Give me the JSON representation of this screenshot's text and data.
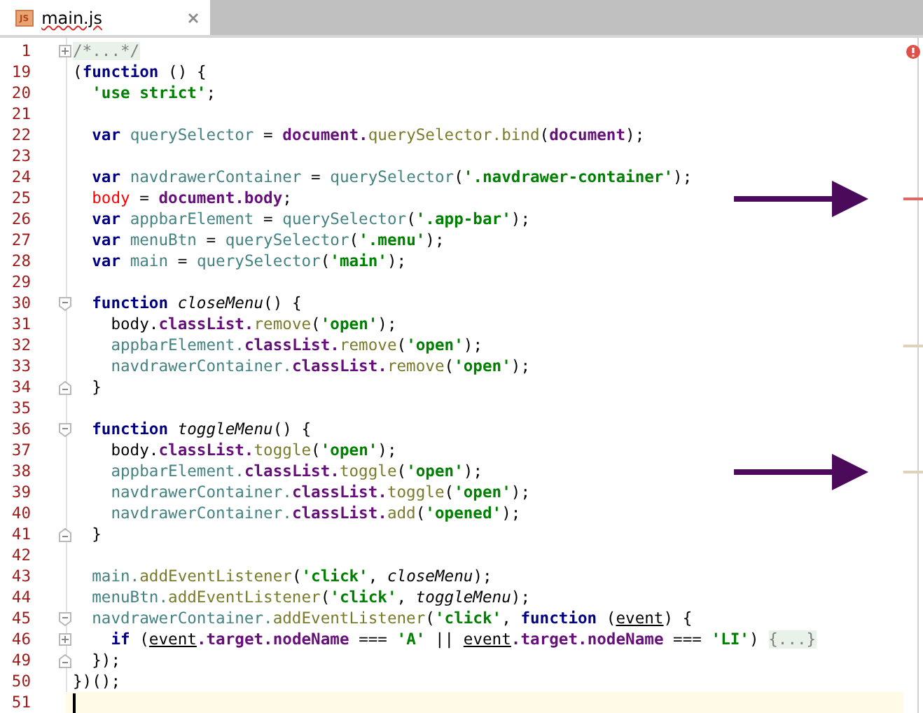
{
  "tabs": [
    {
      "label": "main.js",
      "icon_text": "JS",
      "selected": true,
      "misspelled": true
    }
  ],
  "editor": {
    "has_errors": true,
    "lines": [
      {
        "number": "1",
        "fold": {
          "kind": "expand"
        },
        "current": false,
        "arrow": false,
        "tokens": [
          {
            "text": "/*...*/",
            "kind": "folded"
          }
        ]
      },
      {
        "number": "19",
        "current": false,
        "arrow": false,
        "tokens": [
          {
            "text": "(",
            "kind": "plain"
          },
          {
            "text": "function",
            "kind": "keyword"
          },
          {
            "text": " () {",
            "kind": "plain"
          }
        ]
      },
      {
        "number": "20",
        "current": false,
        "arrow": false,
        "tokens": [
          {
            "text": "  'use strict'",
            "kind": "string"
          },
          {
            "text": ";",
            "kind": "plain"
          }
        ]
      },
      {
        "number": "21",
        "current": false,
        "arrow": false
      },
      {
        "number": "22",
        "current": false,
        "arrow": false,
        "tokens": [
          {
            "text": "  var ",
            "kind": "keyword"
          },
          {
            "text": "querySelector",
            "kind": "local"
          },
          {
            "text": " = ",
            "kind": "plain"
          },
          {
            "text": "document.",
            "kind": "property"
          },
          {
            "text": "querySelector.bind",
            "kind": "method"
          },
          {
            "text": "(",
            "kind": "plain"
          },
          {
            "text": "document",
            "kind": "property"
          },
          {
            "text": ");",
            "kind": "plain"
          }
        ]
      },
      {
        "number": "23",
        "current": false,
        "arrow": false
      },
      {
        "number": "24",
        "current": false,
        "arrow": false,
        "tokens": [
          {
            "text": "  var ",
            "kind": "keyword"
          },
          {
            "text": "navdrawerContainer",
            "kind": "local"
          },
          {
            "text": " = ",
            "kind": "plain"
          },
          {
            "text": "querySelector",
            "kind": "local"
          },
          {
            "text": "(",
            "kind": "plain"
          },
          {
            "text": "'.navdrawer-container'",
            "kind": "string"
          },
          {
            "text": ");",
            "kind": "plain"
          }
        ]
      },
      {
        "number": "25",
        "current": false,
        "arrow": true,
        "stripe": {
          "kind": "error"
        },
        "tokens": [
          {
            "text": "  body",
            "kind": "global"
          },
          {
            "text": " = ",
            "kind": "plain"
          },
          {
            "text": "document.body",
            "kind": "property"
          },
          {
            "text": ";",
            "kind": "plain"
          }
        ]
      },
      {
        "number": "26",
        "current": false,
        "arrow": false,
        "tokens": [
          {
            "text": "  var ",
            "kind": "keyword"
          },
          {
            "text": "appbarElement",
            "kind": "local"
          },
          {
            "text": " = ",
            "kind": "plain"
          },
          {
            "text": "querySelector",
            "kind": "local"
          },
          {
            "text": "(",
            "kind": "plain"
          },
          {
            "text": "'.app-bar'",
            "kind": "string"
          },
          {
            "text": ");",
            "kind": "plain"
          }
        ]
      },
      {
        "number": "27",
        "current": false,
        "arrow": false,
        "tokens": [
          {
            "text": "  var ",
            "kind": "keyword"
          },
          {
            "text": "menuBtn",
            "kind": "local"
          },
          {
            "text": " = ",
            "kind": "plain"
          },
          {
            "text": "querySelector",
            "kind": "local"
          },
          {
            "text": "(",
            "kind": "plain"
          },
          {
            "text": "'.menu'",
            "kind": "string"
          },
          {
            "text": ");",
            "kind": "plain"
          }
        ]
      },
      {
        "number": "28",
        "current": false,
        "arrow": false,
        "tokens": [
          {
            "text": "  var ",
            "kind": "keyword"
          },
          {
            "text": "main",
            "kind": "local"
          },
          {
            "text": " = ",
            "kind": "plain"
          },
          {
            "text": "querySelector",
            "kind": "local"
          },
          {
            "text": "(",
            "kind": "plain"
          },
          {
            "text": "'main'",
            "kind": "string"
          },
          {
            "text": ");",
            "kind": "plain"
          }
        ]
      },
      {
        "number": "29",
        "current": false,
        "arrow": false
      },
      {
        "number": "30",
        "fold": {
          "kind": "start"
        },
        "current": false,
        "arrow": false,
        "tokens": [
          {
            "text": "  function ",
            "kind": "keyword"
          },
          {
            "text": "closeMenu",
            "kind": "function"
          },
          {
            "text": "() {",
            "kind": "plain"
          }
        ]
      },
      {
        "number": "31",
        "current": false,
        "arrow": false,
        "tokens": [
          {
            "text": "    body.",
            "kind": "plain"
          },
          {
            "text": "classList.",
            "kind": "property"
          },
          {
            "text": "remove",
            "kind": "method"
          },
          {
            "text": "(",
            "kind": "plain"
          },
          {
            "text": "'open'",
            "kind": "string"
          },
          {
            "text": ");",
            "kind": "plain"
          }
        ]
      },
      {
        "number": "32",
        "current": false,
        "arrow": false,
        "stripe": {
          "kind": "warning"
        },
        "tokens": [
          {
            "text": "    appbarElement.",
            "kind": "local"
          },
          {
            "text": "classList.",
            "kind": "property"
          },
          {
            "text": "remove",
            "kind": "method"
          },
          {
            "text": "(",
            "kind": "plain"
          },
          {
            "text": "'open'",
            "kind": "string"
          },
          {
            "text": ");",
            "kind": "plain"
          }
        ]
      },
      {
        "number": "33",
        "current": false,
        "arrow": false,
        "tokens": [
          {
            "text": "    navdrawerContainer.",
            "kind": "local"
          },
          {
            "text": "classList.",
            "kind": "property"
          },
          {
            "text": "remove",
            "kind": "method"
          },
          {
            "text": "(",
            "kind": "plain"
          },
          {
            "text": "'open'",
            "kind": "string"
          },
          {
            "text": ");",
            "kind": "plain"
          }
        ]
      },
      {
        "number": "34",
        "fold": {
          "kind": "end"
        },
        "current": false,
        "arrow": false,
        "tokens": [
          {
            "text": "  }",
            "kind": "plain"
          }
        ]
      },
      {
        "number": "35",
        "current": false,
        "arrow": false
      },
      {
        "number": "36",
        "fold": {
          "kind": "start"
        },
        "current": false,
        "arrow": false,
        "tokens": [
          {
            "text": "  function ",
            "kind": "keyword"
          },
          {
            "text": "toggleMenu",
            "kind": "function"
          },
          {
            "text": "() {",
            "kind": "plain"
          }
        ]
      },
      {
        "number": "37",
        "current": false,
        "arrow": false,
        "tokens": [
          {
            "text": "    body.",
            "kind": "plain"
          },
          {
            "text": "classList.",
            "kind": "property"
          },
          {
            "text": "toggle",
            "kind": "method"
          },
          {
            "text": "(",
            "kind": "plain"
          },
          {
            "text": "'open'",
            "kind": "string"
          },
          {
            "text": ");",
            "kind": "plain"
          }
        ]
      },
      {
        "number": "38",
        "current": false,
        "arrow": true,
        "stripe": {
          "kind": "warning"
        },
        "tokens": [
          {
            "text": "    appbarElement.",
            "kind": "local"
          },
          {
            "text": "classList.",
            "kind": "property"
          },
          {
            "text": "toggle",
            "kind": "method"
          },
          {
            "text": "(",
            "kind": "plain"
          },
          {
            "text": "'open'",
            "kind": "string"
          },
          {
            "text": ");",
            "kind": "plain"
          }
        ]
      },
      {
        "number": "39",
        "current": false,
        "arrow": false,
        "tokens": [
          {
            "text": "    navdrawerContainer.",
            "kind": "local"
          },
          {
            "text": "classList.",
            "kind": "property"
          },
          {
            "text": "toggle",
            "kind": "method"
          },
          {
            "text": "(",
            "kind": "plain"
          },
          {
            "text": "'open'",
            "kind": "string"
          },
          {
            "text": ");",
            "kind": "plain"
          }
        ]
      },
      {
        "number": "40",
        "current": false,
        "arrow": false,
        "tokens": [
          {
            "text": "    navdrawerContainer.",
            "kind": "local"
          },
          {
            "text": "classList.",
            "kind": "property"
          },
          {
            "text": "add",
            "kind": "method"
          },
          {
            "text": "(",
            "kind": "plain"
          },
          {
            "text": "'opened'",
            "kind": "string"
          },
          {
            "text": ");",
            "kind": "plain"
          }
        ]
      },
      {
        "number": "41",
        "fold": {
          "kind": "end"
        },
        "current": false,
        "arrow": false,
        "tokens": [
          {
            "text": "  }",
            "kind": "plain"
          }
        ]
      },
      {
        "number": "42",
        "current": false,
        "arrow": false
      },
      {
        "number": "43",
        "current": false,
        "arrow": false,
        "tokens": [
          {
            "text": "  main.",
            "kind": "local"
          },
          {
            "text": "addEventListener",
            "kind": "method"
          },
          {
            "text": "(",
            "kind": "plain"
          },
          {
            "text": "'click'",
            "kind": "string"
          },
          {
            "text": ", ",
            "kind": "plain"
          },
          {
            "text": "closeMenu",
            "kind": "function"
          },
          {
            "text": ");",
            "kind": "plain"
          }
        ]
      },
      {
        "number": "44",
        "current": false,
        "arrow": false,
        "tokens": [
          {
            "text": "  menuBtn.",
            "kind": "local"
          },
          {
            "text": "addEventListener",
            "kind": "method"
          },
          {
            "text": "(",
            "kind": "plain"
          },
          {
            "text": "'click'",
            "kind": "string"
          },
          {
            "text": ", ",
            "kind": "plain"
          },
          {
            "text": "toggleMenu",
            "kind": "function"
          },
          {
            "text": ");",
            "kind": "plain"
          }
        ]
      },
      {
        "number": "45",
        "fold": {
          "kind": "start"
        },
        "current": false,
        "arrow": false,
        "tokens": [
          {
            "text": "  navdrawerContainer.",
            "kind": "local"
          },
          {
            "text": "addEventListener",
            "kind": "method"
          },
          {
            "text": "(",
            "kind": "plain"
          },
          {
            "text": "'click'",
            "kind": "string"
          },
          {
            "text": ", ",
            "kind": "plain"
          },
          {
            "text": "function",
            "kind": "keyword"
          },
          {
            "text": " (",
            "kind": "plain"
          },
          {
            "text": "event",
            "kind": "param"
          },
          {
            "text": ") {",
            "kind": "plain"
          }
        ]
      },
      {
        "number": "46",
        "fold": {
          "kind": "expand"
        },
        "current": false,
        "arrow": false,
        "tokens": [
          {
            "text": "    if",
            "kind": "keyword"
          },
          {
            "text": " (",
            "kind": "plain"
          },
          {
            "text": "event",
            "kind": "param"
          },
          {
            "text": ".target.nodeName",
            "kind": "property"
          },
          {
            "text": " === ",
            "kind": "plain"
          },
          {
            "text": "'A'",
            "kind": "string"
          },
          {
            "text": " || ",
            "kind": "plain"
          },
          {
            "text": "event",
            "kind": "param"
          },
          {
            "text": ".target.nodeName",
            "kind": "property"
          },
          {
            "text": " === ",
            "kind": "plain"
          },
          {
            "text": "'LI'",
            "kind": "string"
          },
          {
            "text": ") ",
            "kind": "plain"
          },
          {
            "text": "{...}",
            "kind": "folded"
          }
        ]
      },
      {
        "number": "49",
        "fold": {
          "kind": "end"
        },
        "current": false,
        "arrow": false,
        "tokens": [
          {
            "text": "  });",
            "kind": "plain"
          }
        ]
      },
      {
        "number": "50",
        "current": false,
        "arrow": false,
        "tokens": [
          {
            "text": "})();",
            "kind": "plain"
          }
        ]
      },
      {
        "number": "51",
        "current": true,
        "arrow": false
      }
    ]
  }
}
